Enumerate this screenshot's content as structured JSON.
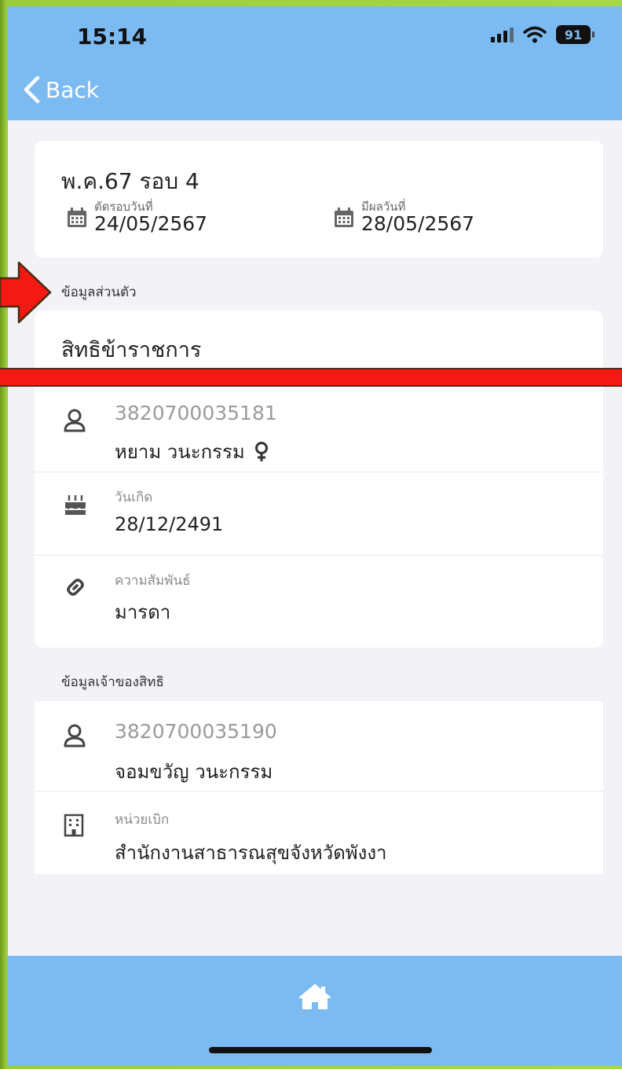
{
  "status_bar": {
    "time": "15:14",
    "battery_level": "91"
  },
  "nav": {
    "back_label": "Back"
  },
  "round_card": {
    "title": "พ.ค.67 รอบ 4",
    "cutoff_label": "ตัดรอบวันที่",
    "cutoff_date": "24/05/2567",
    "result_label": "มีผลวันที่",
    "result_date": "28/05/2567"
  },
  "personal_section": {
    "heading": "ข้อมูลส่วนตัว",
    "rights_title": "สิทธิข้าราชการ",
    "id_number": "3820700035181",
    "name": "หยาม  วนะกรรม",
    "birth_label": "วันเกิด",
    "birth_date": "28/12/2491",
    "relation_label": "ความสัมพันธ์",
    "relation_value": "มารดา"
  },
  "owner_section": {
    "heading": "ข้อมูลเจ้าของสิทธิ",
    "id_number": "3820700035190",
    "name": "จอมขวัญ วนะกรรม",
    "unit_label": "หน่วยเบิก",
    "unit_value": "สำนักงานสาธารณสุขจังหวัดพังงา"
  },
  "colors": {
    "header": "#7cbaf2",
    "overlay_red": "#f21a12",
    "frame_green": "#a8d84a"
  }
}
